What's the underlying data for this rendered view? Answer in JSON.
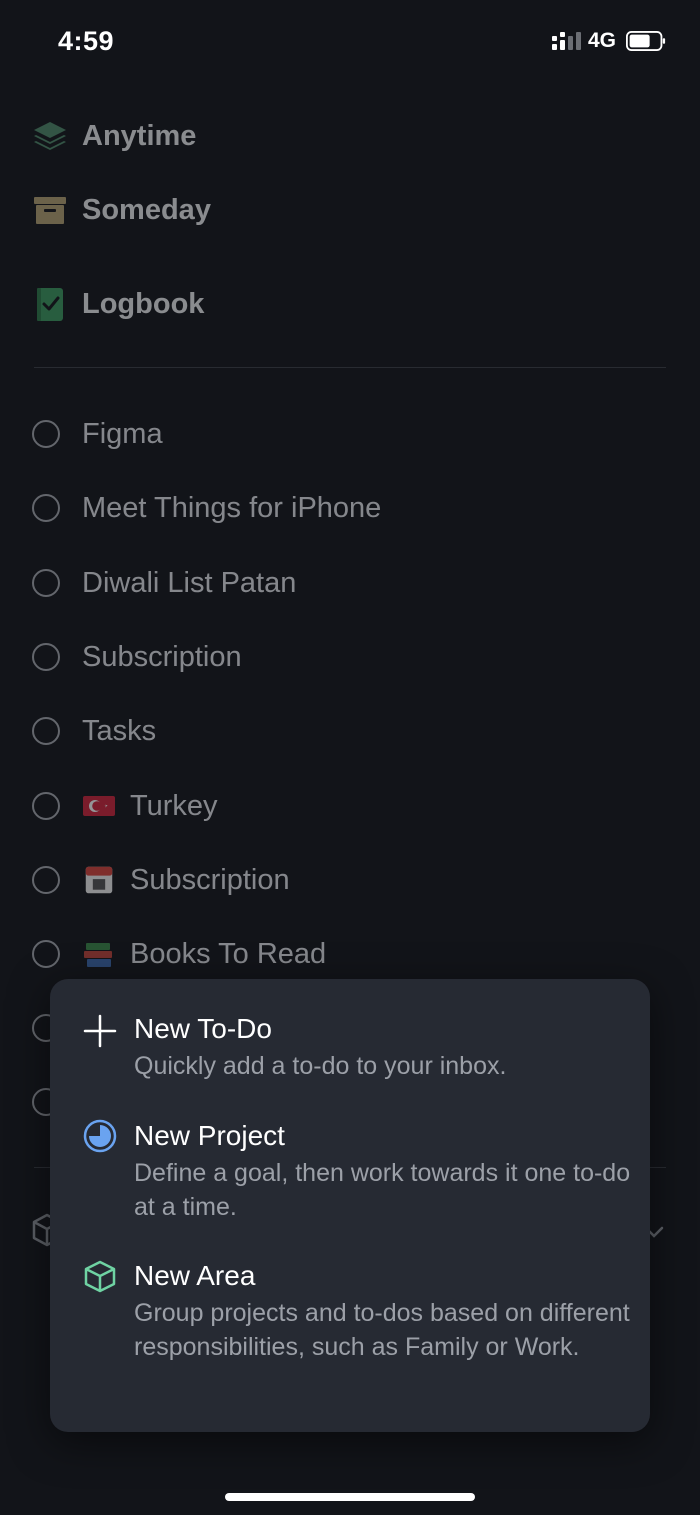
{
  "status": {
    "time": "4:59",
    "network": "4G"
  },
  "nav": {
    "anytime": "Anytime",
    "someday": "Someday",
    "logbook": "Logbook"
  },
  "projects": [
    {
      "label": "Figma",
      "emoji": ""
    },
    {
      "label": "Meet Things for iPhone",
      "emoji": ""
    },
    {
      "label": "Diwali List Patan",
      "emoji": ""
    },
    {
      "label": "Subscription",
      "emoji": ""
    },
    {
      "label": "Tasks",
      "emoji": ""
    },
    {
      "label": "Turkey",
      "emoji": "turkey-flag-icon"
    },
    {
      "label": "Subscription",
      "emoji": "calendar-icon"
    },
    {
      "label": "Books To Read",
      "emoji": "books-icon"
    }
  ],
  "menu": {
    "new_todo": {
      "title": "New To-Do",
      "desc": "Quickly add a to-do to your inbox."
    },
    "new_project": {
      "title": "New Project",
      "desc": "Define a goal, then work towards it one to-do at a time."
    },
    "new_area": {
      "title": "New Area",
      "desc": "Group projects and to-dos based on different responsibilities, such as Family or Work."
    }
  },
  "colors": {
    "background": "#121419",
    "popup": "#262a33",
    "project_blue": "#6aa3f0",
    "area_green": "#6fd3a3",
    "anytime_green": "#4e8a6a",
    "someday_tan": "#b5a273",
    "logbook_green": "#3a9a5e"
  }
}
